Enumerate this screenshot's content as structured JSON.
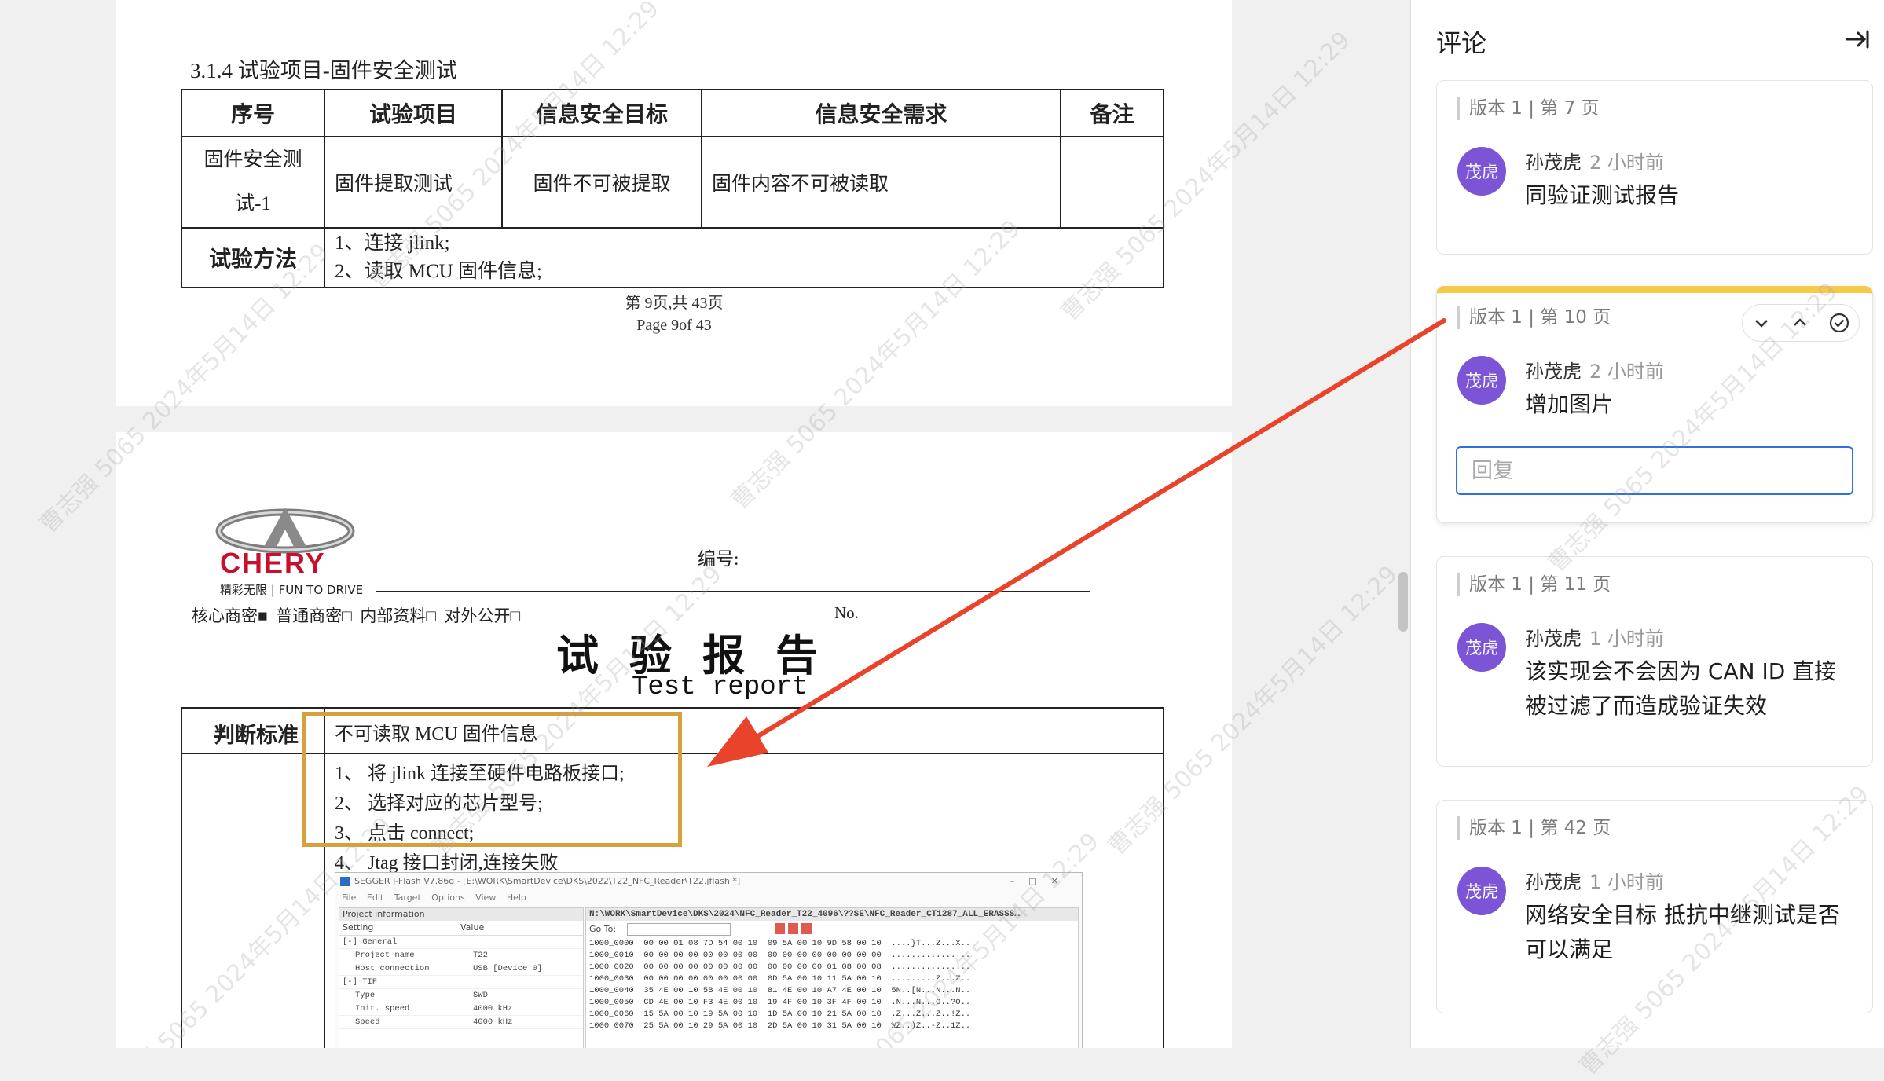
{
  "document": {
    "page1": {
      "section_heading": "3.1.4  试验项目-固件安全测试",
      "table_headers": [
        "序号",
        "试验项目",
        "信息安全目标",
        "信息安全需求",
        "备注"
      ],
      "row": {
        "id_line1": "固件安全测",
        "id_line2": "试-1",
        "item": "固件提取测试",
        "goal": "固件不可被提取",
        "requirement": "固件内容不可被读取",
        "note": ""
      },
      "method_label": "试验方法",
      "method_steps": [
        "1、连接 jlink;",
        "2、读取 MCU 固件信息;"
      ],
      "footer_cn": "第 9页,共 43页",
      "footer_en": "Page 9of 43"
    },
    "page2": {
      "logo_text": "CHERY",
      "logo_tagline": "精彩无限 | FUN TO DRIVE",
      "number_label": "编号:",
      "number_label_en": "No.",
      "classification": "核心商密■  普通商密□  内部资料□  对外公开□",
      "title_cn": "试  验  报  告",
      "title_en": "Test report",
      "criteria_label": "判断标准",
      "criteria_text": "不可读取 MCU 固件信息",
      "steps": [
        "1、 将 jlink 连接至硬件电路板接口;",
        "2、 选择对应的芯片型号;",
        "3、 点击 connect;",
        "4、 Jtag 接口封闭,连接失败"
      ],
      "jflash": {
        "title": "SEGGER J-Flash V7.86g - [E:\\WORK\\SmartDevice\\DKS\\2022\\T22_NFC_Reader\\T22.jflash *]",
        "menu": [
          "File",
          "Edit",
          "Target",
          "Options",
          "View",
          "Help"
        ],
        "panel_left_title": "Project information",
        "panel_right_title": "N:\\WORK\\SmartDevice\\DKS\\2024\\NFC_Reader_T22_4096\\??SE\\NFC_Reader_CT1287_ALL_ERASSS…",
        "goto_label": "Go To:",
        "col_setting": "Setting",
        "col_value": "Value",
        "rows": [
          [
            "[-] General",
            ""
          ],
          [
            "Project name",
            "T22"
          ],
          [
            "Host connection",
            "USB [Device 0]"
          ],
          [
            "[-] TIF",
            ""
          ],
          [
            "Type",
            "SWD"
          ],
          [
            "Init. speed",
            "4000 kHz"
          ],
          [
            "Speed",
            "4000 kHz"
          ]
        ],
        "hex_lines": [
          "1000_0000  00 00 01 08 7D 54 00 10  09 5A 00 10 9D 58 00 10  ....}T...Z...X..",
          "1000_0010  00 00 00 00 00 00 00 00  00 00 00 00 00 00 00 00  ................",
          "1000_0020  00 00 00 00 00 00 00 00  00 00 00 00 01 08 00 08  ................",
          "1000_0030  00 00 00 00 00 00 00 00  0D 5A 00 10 11 5A 00 10  .........Z...Z..",
          "1000_0040  35 4E 00 10 5B 4E 00 10  81 4E 00 10 A7 4E 00 10  5N..[N...N...N..",
          "1000_0050  CD 4E 00 10 F3 4E 00 10  19 4F 00 10 3F 4F 00 10  .N...N...O..?O..",
          "1000_0060  15 5A 00 10 19 5A 00 10  1D 5A 00 10 21 5A 00 10  .Z...Z...Z..!Z..",
          "1000_0070  25 5A 00 10 29 5A 00 10  2D 5A 00 10 31 5A 00 10  %Z..)Z..-Z..1Z.."
        ]
      }
    },
    "watermark": "曹志强 5065 2024年5月14日 12:29"
  },
  "sidebar": {
    "title": "评论",
    "reply_placeholder": "回复",
    "comments": [
      {
        "version": "版本 1 | 第 7 页",
        "avatar": "茂虎",
        "author": "孙茂虎",
        "time": "2 小时前",
        "text": "同验证测试报告"
      },
      {
        "version": "版本 1 | 第 10 页",
        "avatar": "茂虎",
        "author": "孙茂虎",
        "time": "2 小时前",
        "text": "增加图片"
      },
      {
        "version": "版本 1 | 第 11 页",
        "avatar": "茂虎",
        "author": "孙茂虎",
        "time": "1 小时前",
        "text": "该实现会不会因为 CAN ID 直接被过滤了而造成验证失效"
      },
      {
        "version": "版本 1 | 第 42 页",
        "avatar": "茂虎",
        "author": "孙茂虎",
        "time": "1 小时前",
        "text": "网络安全目标 抵抗中继测试是否可以满足"
      }
    ]
  },
  "colors": {
    "avatar": "#7b55d6",
    "active_bar": "#f7c948",
    "highlight_box": "#d8a03a",
    "arrow": "#e9432c",
    "input_focus": "#2f6fe0",
    "chery_red": "#c8102e"
  }
}
